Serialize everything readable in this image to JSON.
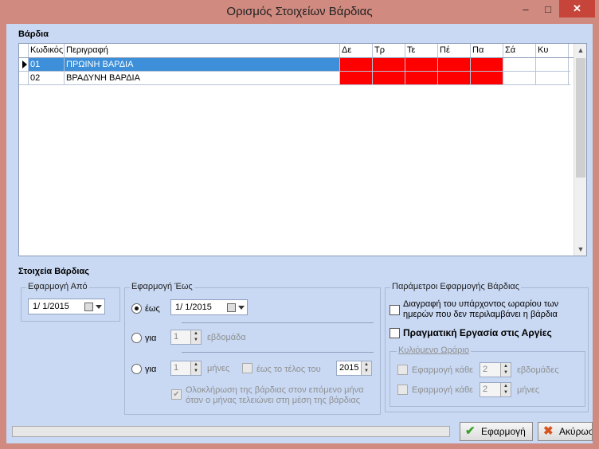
{
  "window": {
    "title": "Ορισμός Στοιχείων Βάρδιας",
    "minimize_icon": "–",
    "maximize_icon": "□",
    "close_icon": "✕"
  },
  "shifts": {
    "header": "Βάρδια",
    "columns": [
      "Κωδικός",
      "Περιγραφή",
      "Δε",
      "Τρ",
      "Τε",
      "Πέ",
      "Πα",
      "Σά",
      "Κυ"
    ],
    "rows": [
      {
        "code": "01",
        "desc": "ΠΡΩΙΝΗ ΒΑΡΔΙΑ"
      },
      {
        "code": "02",
        "desc": "ΒΡΑΔΥΝΗ ΒΑΡΔΙΑ"
      }
    ],
    "red_color": "#ff0000",
    "selection_color": "#3c8fd8"
  },
  "details": {
    "header": "Στοιχεία Βάρδιας",
    "from": {
      "label": "Εφαρμογή Από",
      "date": "1/ 1/2015"
    },
    "to": {
      "label": "Εφαρμογή Έως",
      "until_label": "έως",
      "until_date": "1/ 1/2015",
      "for_label": "για",
      "weeks_value": "1",
      "weeks_unit": "εβδομάδα",
      "months_value": "1",
      "months_unit": "μήνες",
      "end_of_label": "έως το τέλος του",
      "year_value": "2015",
      "completion_text_1": "Ολοκλήρωση της βάρδιας στον επόμενο μήνα",
      "completion_text_2": "όταν ο μήνας τελειώνει στη μέση της βάρδιας"
    },
    "params": {
      "label": "Παράμετροι Εφαρμογής Βάρδιας",
      "delete_text_1": "Διαγραφή του υπάρχοντος ωραρίου των",
      "delete_text_2": "ημερών που δεν περιλαμβάνει η βάρδια",
      "real_work_label": "Πραγματική Εργασία στις Αργίες",
      "rolling": {
        "label": "Κυλιόμενο Ωράριο",
        "apply_every": "Εφαρμογή κάθε",
        "weeks_value": "2",
        "weeks_unit": "εβδομάδες",
        "months_value": "2",
        "months_unit": "μήνες"
      }
    }
  },
  "buttons": {
    "apply": "Εφαρμογή",
    "cancel": "Ακύρωση"
  },
  "icons": {
    "check": "✔",
    "up": "▲",
    "down": "▼",
    "apply": "✔",
    "cancel": "✖"
  }
}
